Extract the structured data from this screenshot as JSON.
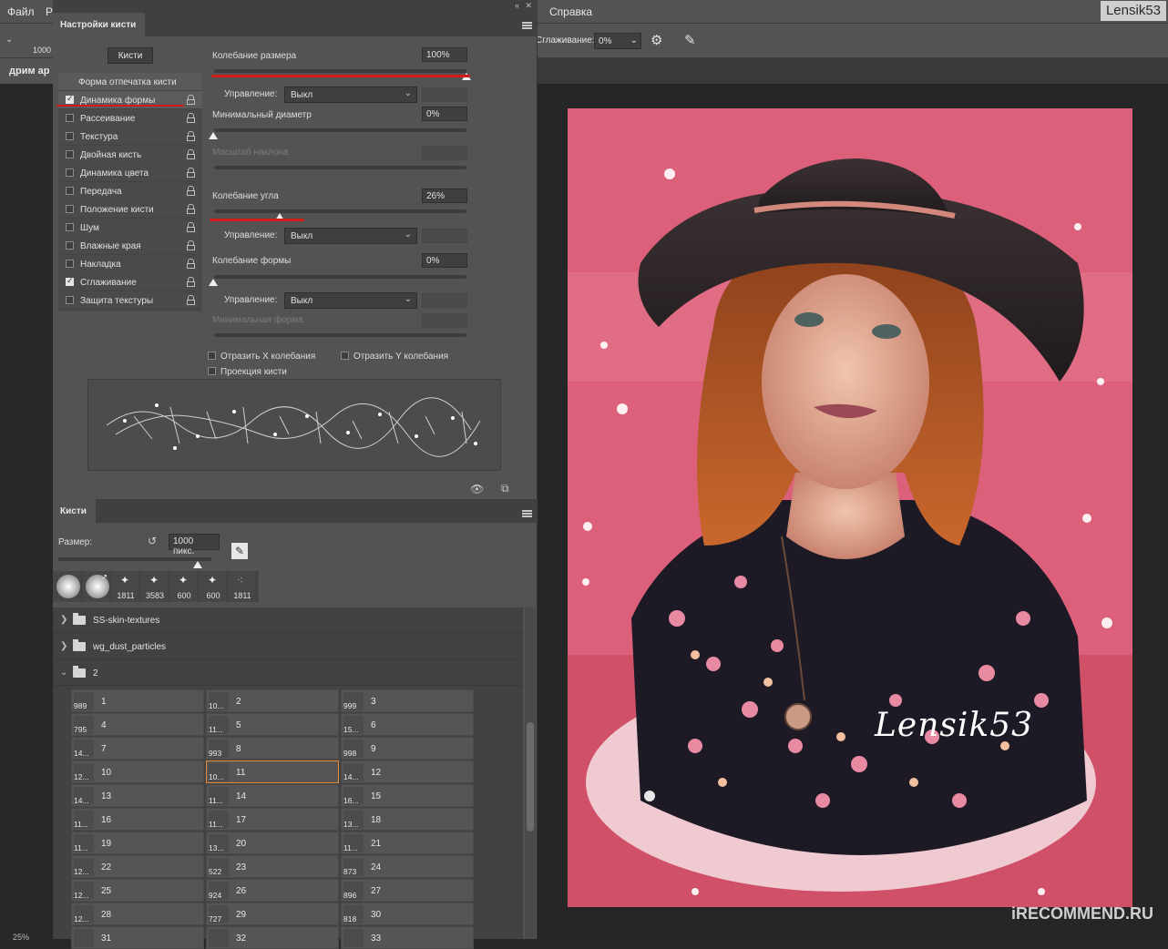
{
  "menu": {
    "file": "Файл",
    "edit_partial": "Р",
    "help": "Справка",
    "user": "Lensik53"
  },
  "options_bar": {
    "brush_size": "1000",
    "smoothing_label": "Сглаживание:",
    "smoothing_value": "0%"
  },
  "document_tab": {
    "title": "дрим ар"
  },
  "brush_settings": {
    "tab": "Настройки кисти",
    "brushes_button": "Кисти",
    "options": [
      {
        "label": "Форма отпечатка кисти",
        "checked": false,
        "header": true
      },
      {
        "label": "Динамика формы",
        "checked": true
      },
      {
        "label": "Рассеивание",
        "checked": false
      },
      {
        "label": "Текстура",
        "checked": false
      },
      {
        "label": "Двойная кисть",
        "checked": false
      },
      {
        "label": "Динамика цвета",
        "checked": false
      },
      {
        "label": "Передача",
        "checked": false
      },
      {
        "label": "Положение кисти",
        "checked": false
      },
      {
        "label": "Шум",
        "checked": false
      },
      {
        "label": "Влажные края",
        "checked": false
      },
      {
        "label": "Накладка",
        "checked": false
      },
      {
        "label": "Сглаживание",
        "checked": true
      },
      {
        "label": "Защита текстуры",
        "checked": false
      }
    ],
    "size_jitter": {
      "label": "Колебание размера",
      "value": "100%",
      "level": 1.0
    },
    "control_label": "Управление:",
    "control_value": "Выкл",
    "min_diameter": {
      "label": "Минимальный диаметр",
      "value": "0%",
      "level": 0.0
    },
    "tilt_scale": {
      "label": "Масштаб наклона"
    },
    "angle_jitter": {
      "label": "Колебание угла",
      "value": "26%",
      "level": 0.26
    },
    "roundness_jitter": {
      "label": "Колебание формы",
      "value": "0%",
      "level": 0.0
    },
    "min_roundness": {
      "label": "Минимальная форма"
    },
    "flip_x": "Отразить X колебания",
    "flip_y": "Отразить Y колебания",
    "brush_projection": "Проекция кисти",
    "accent_color": "#d21a1a"
  },
  "brushes_panel": {
    "tab": "Кисти",
    "size_label": "Размер:",
    "size_value": "1000 пикс.",
    "size_level": 1.0,
    "presets": [
      "",
      "",
      "1811",
      "3583",
      "600",
      "600",
      "1811"
    ],
    "folders": [
      {
        "name": "SS-skin-textures",
        "arrow": "❯"
      },
      {
        "name": "wg_dust_particles",
        "arrow": "❯"
      },
      {
        "name": "2",
        "arrow": "⌄"
      }
    ],
    "tiles": [
      {
        "size": "989",
        "name": "1"
      },
      {
        "size": "10...",
        "name": "2"
      },
      {
        "size": "999",
        "name": "3"
      },
      {
        "size": "795",
        "name": "4"
      },
      {
        "size": "11...",
        "name": "5"
      },
      {
        "size": "15...",
        "name": "6"
      },
      {
        "size": "14...",
        "name": "7"
      },
      {
        "size": "993",
        "name": "8"
      },
      {
        "size": "998",
        "name": "9"
      },
      {
        "size": "12...",
        "name": "10"
      },
      {
        "size": "10...",
        "name": "11"
      },
      {
        "size": "14...",
        "name": "12"
      },
      {
        "size": "14...",
        "name": "13"
      },
      {
        "size": "11...",
        "name": "14"
      },
      {
        "size": "16...",
        "name": "15"
      },
      {
        "size": "11...",
        "name": "16"
      },
      {
        "size": "11...",
        "name": "17"
      },
      {
        "size": "13...",
        "name": "18"
      },
      {
        "size": "11...",
        "name": "19"
      },
      {
        "size": "13...",
        "name": "20"
      },
      {
        "size": "11...",
        "name": "21"
      },
      {
        "size": "12...",
        "name": "22"
      },
      {
        "size": "522",
        "name": "23"
      },
      {
        "size": "873",
        "name": "24"
      },
      {
        "size": "12...",
        "name": "25"
      },
      {
        "size": "924",
        "name": "26"
      },
      {
        "size": "896",
        "name": "27"
      },
      {
        "size": "12...",
        "name": "28"
      },
      {
        "size": "727",
        "name": "29"
      },
      {
        "size": "818",
        "name": "30"
      },
      {
        "size": "",
        "name": "31"
      },
      {
        "size": "",
        "name": "32"
      },
      {
        "size": "",
        "name": "33"
      }
    ],
    "selected_tile": "11"
  },
  "canvas": {
    "signature": "Lensik53",
    "bg_color": "#d6536f"
  },
  "watermark": "iRECOMMEND.RU",
  "zoom_partial": "25%"
}
